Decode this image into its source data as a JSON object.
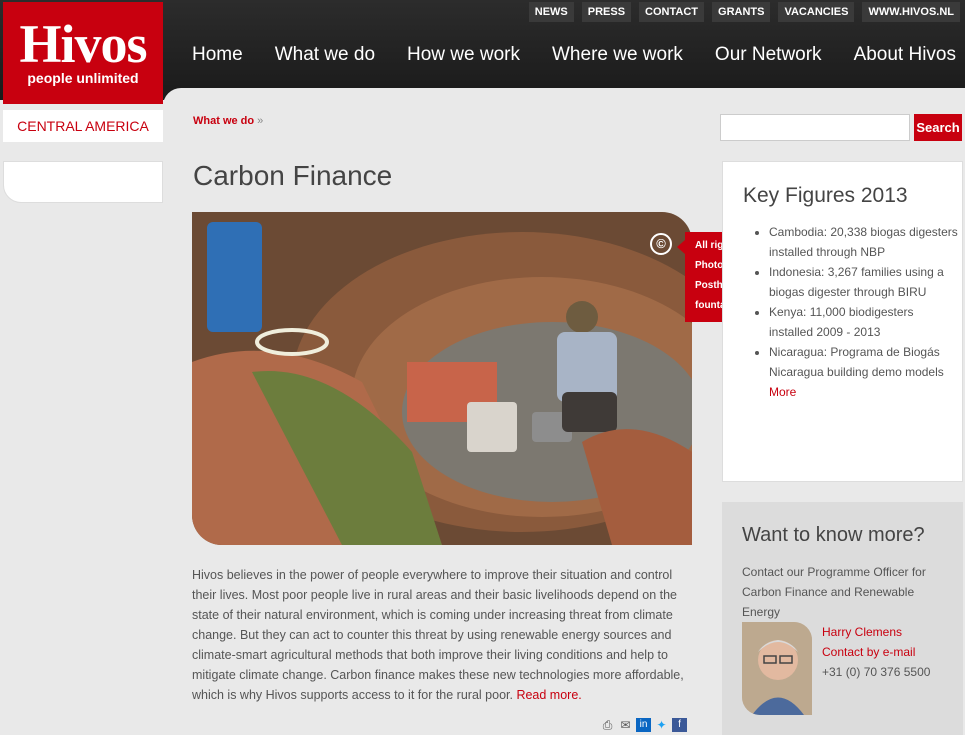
{
  "brand": {
    "name": "Hivos",
    "tagline": "people unlimited",
    "region": "CENTRAL AMERICA",
    "accent": "#c8000f"
  },
  "topnav": [
    "NEWS",
    "PRESS",
    "CONTACT",
    "GRANTS",
    "VACANCIES",
    "WWW.HIVOS.NL"
  ],
  "mainnav": [
    "Home",
    "What we do",
    "How we work",
    "Where we work",
    "Our Network",
    "About Hivos"
  ],
  "breadcrumb": {
    "link": "What we do",
    "sep": "»"
  },
  "search": {
    "placeholder": "",
    "button": "Search"
  },
  "page": {
    "title": "Carbon Finance"
  },
  "photo": {
    "copyright_icon": "copyright-icon",
    "credit": [
      "All rights reserved.",
      "Photo: Ivo",
      "Posthumus - Story",
      "fountain Ltd."
    ]
  },
  "body": {
    "text": "Hivos believes in the power of people everywhere to improve their situation and control their lives. Most poor people live in rural areas and their basic livelihoods depend on the state of their natural environment, which is coming under increasing threat from climate change. But they can act to counter this threat by using renewable energy sources and climate-smart agricultural methods that both improve their living conditions and help to mitigate climate change. Carbon finance makes these new technologies more affordable, which is why Hivos supports access to it for the rural poor.",
    "read_more": "Read more."
  },
  "share_icons": [
    "print-icon",
    "email-icon",
    "linkedin-icon",
    "twitter-icon",
    "facebook-icon"
  ],
  "key_figures": {
    "title": "Key Figures 2013",
    "items": [
      "Cambodia: 20,338 biogas digesters installed through NBP",
      "Indonesia: 3,267 families using a biogas digester through BIRU",
      "Kenya: 11,000 biodigesters installed 2009 - 2013",
      "Nicaragua: Programa de Biogás Nicaragua building demo models"
    ],
    "more": "More"
  },
  "want_to_know": {
    "title": "Want to know more?",
    "text": "Contact our Programme Officer for Carbon Finance and Renewable Energy",
    "name": "Harry Clemens",
    "email_label": "Contact by e-mail",
    "phone": "+31 (0) 70 376 5500"
  }
}
